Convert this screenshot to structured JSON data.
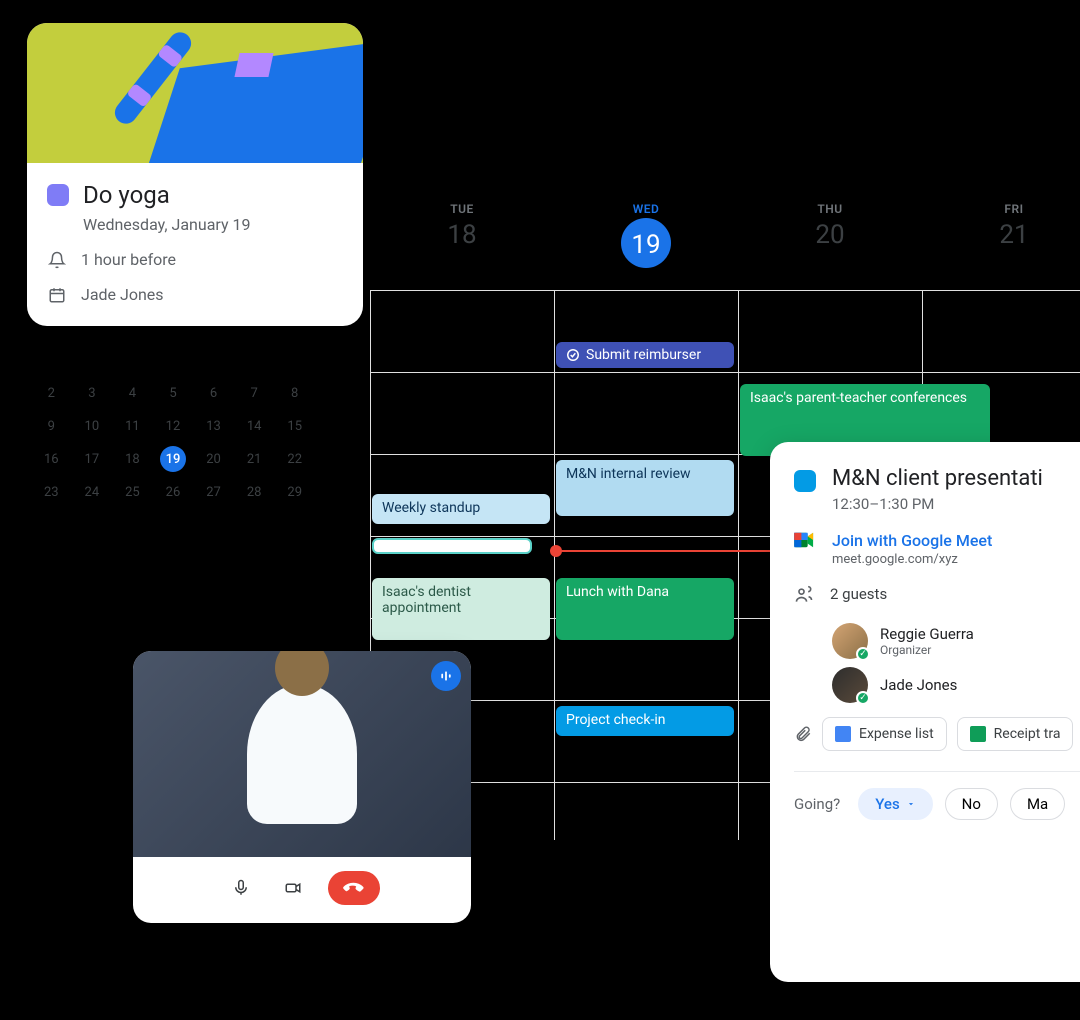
{
  "event_card": {
    "title": "Do yoga",
    "subtitle": "Wednesday, January 19",
    "reminder": "1 hour before",
    "owner": "Jade Jones"
  },
  "mini_month": {
    "days": [
      2,
      3,
      4,
      5,
      6,
      7,
      8,
      9,
      10,
      11,
      12,
      13,
      14,
      15,
      16,
      17,
      18,
      19,
      20,
      21,
      22,
      23,
      24,
      25,
      26,
      27,
      28,
      29
    ],
    "selected": 19
  },
  "week_header": [
    {
      "wd": "TUE",
      "dn": "18"
    },
    {
      "wd": "WED",
      "dn": "19",
      "selected": true
    },
    {
      "wd": "THU",
      "dn": "20"
    },
    {
      "wd": "FRI",
      "dn": "21"
    }
  ],
  "events": {
    "submit": "Submit reimburser",
    "parent": "Isaac's parent-teacher conferences",
    "standup": "Weekly standup",
    "review": "M&N internal review",
    "dentist": "Isaac's dentist appointment",
    "lunch": "Lunch with Dana",
    "project": "Project check-in"
  },
  "detail": {
    "title": "M&N client presentati",
    "time": "12:30–1:30 PM",
    "meet_label": "Join with Google Meet",
    "meet_url": "meet.google.com/xyz",
    "guests_count": "2 guests",
    "guests": [
      {
        "name": "Reggie Guerra",
        "role": "Organizer"
      },
      {
        "name": "Jade Jones",
        "role": ""
      }
    ],
    "attachments": [
      "Expense list",
      "Receipt tra"
    ],
    "rsvp_label": "Going?",
    "rsvp_yes": "Yes",
    "rsvp_no": "No",
    "rsvp_maybe": "Ma"
  }
}
